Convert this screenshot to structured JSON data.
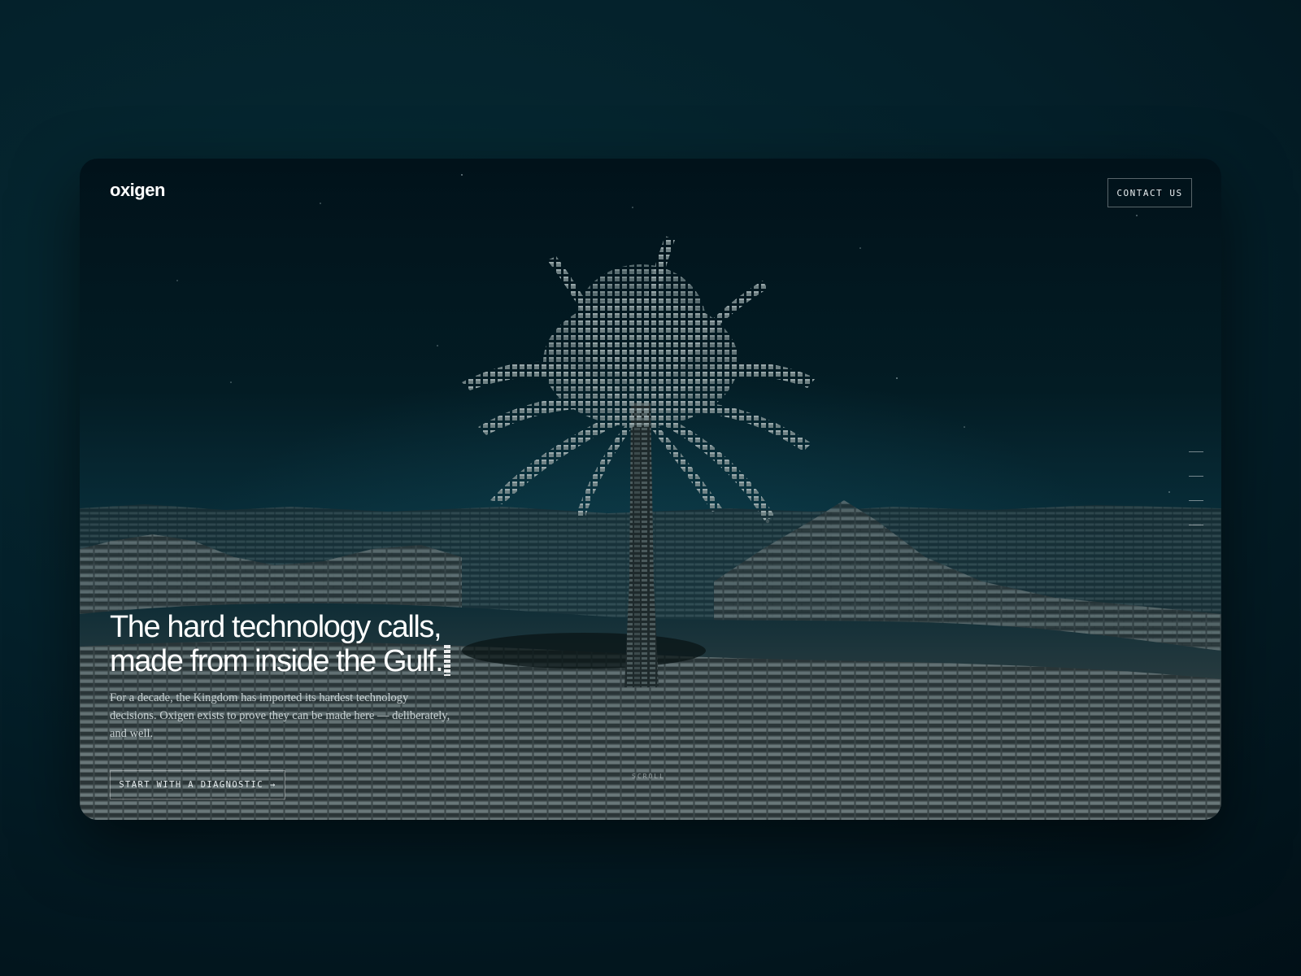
{
  "brand": {
    "logo_text": "oxigen"
  },
  "header": {
    "contact_label": "CONTACT US"
  },
  "hero": {
    "headline_line1": "The hard technology calls,",
    "headline_line2": "made from inside the Gulf.",
    "lede": "For a decade, the Kingdom has imported its hardest technology decisions. Oxigen exists to prove they can be made here — deliberately, and well.",
    "cta_label": "START WITH A DIAGNOSTIC",
    "cta_arrow": "→",
    "scroll_label": "SCROLL"
  },
  "side_nav": {
    "items": [
      "section-1",
      "section-2",
      "section-3",
      "section-4"
    ]
  },
  "colors": {
    "page_bg": "#04202a",
    "frame_top": "#01121a",
    "frame_mid": "#0a3340",
    "voxel_light": "#8a9a9c",
    "voxel_dark": "#2c3638",
    "text": "#ffffff"
  },
  "icons": {
    "cta_arrow": "right-arrow-icon",
    "headline_cursor": "blinking-cursor-icon"
  }
}
